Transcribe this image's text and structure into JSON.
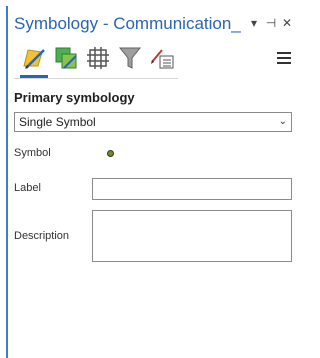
{
  "pane": {
    "title": "Symbology - Communication_...",
    "buttons": {
      "dropdown_glyph": "▾",
      "pin_glyph": "⊣",
      "close_glyph": "✕"
    }
  },
  "toolbar": {
    "tools": [
      {
        "name": "primary-symbology-icon",
        "active": true
      },
      {
        "name": "vary-symbology-icon",
        "active": false
      },
      {
        "name": "symbol-layers-icon",
        "active": false
      },
      {
        "name": "filter-icon",
        "active": false
      },
      {
        "name": "advanced-symbology-icon",
        "active": false
      }
    ],
    "menu_icon": "hamburger-menu-icon"
  },
  "primary": {
    "heading": "Primary symbology",
    "selected": "Single Symbol",
    "chevron": "⌄"
  },
  "form": {
    "symbol_label": "Symbol",
    "label_label": "Label",
    "label_value": "",
    "description_label": "Description",
    "description_value": ""
  },
  "colors": {
    "accent": "#2a64b4",
    "symbol_fill": "#6d8f1a"
  }
}
